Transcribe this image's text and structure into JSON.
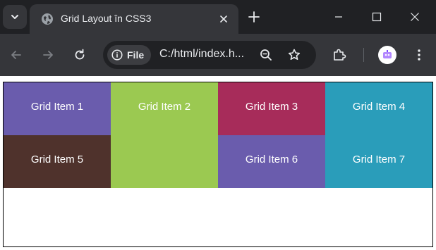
{
  "tab": {
    "title": "Grid Layout în CSS3",
    "favicon": "globe-icon"
  },
  "toolbar": {
    "icons": [
      "back-arrow-icon",
      "forward-arrow-icon",
      "reload-icon",
      "zoom-out-icon",
      "bookmark-star-icon",
      "extensions-icon",
      "menu-icon"
    ]
  },
  "omnibox": {
    "chip_label": "File",
    "url": "C:/html/index.h..."
  },
  "page": {
    "items": [
      {
        "label": "Grid Item 1",
        "color": "#6a5cad"
      },
      {
        "label": "Grid Item 2",
        "color": "#9bc951"
      },
      {
        "label": "Grid Item 3",
        "color": "#a72c5a"
      },
      {
        "label": "Grid Item 4",
        "color": "#2a9dba"
      },
      {
        "label": "Grid Item 5",
        "color": "#4f322c"
      },
      {
        "label": "Grid Item 6",
        "color": "#6a5cad"
      },
      {
        "label": "Grid Item 7",
        "color": "#2a9dba"
      }
    ]
  },
  "colors": {
    "tabstrip": "#202124",
    "toolbar": "#35363a",
    "text": "#e8eaed"
  }
}
